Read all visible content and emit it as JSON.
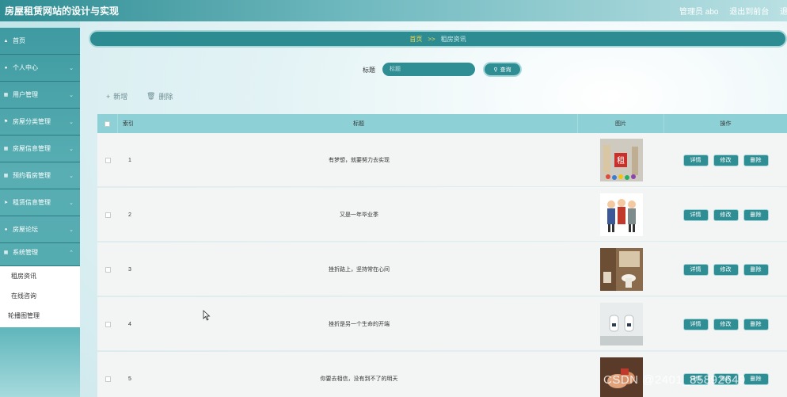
{
  "header": {
    "title": "房屋租赁网站的设计与实现",
    "user": "管理员 abo",
    "back_to_front": "退出到前台",
    "logout": "退出登"
  },
  "sidebar": {
    "items": [
      {
        "label": "首页",
        "icon": "home-icon"
      },
      {
        "label": "个人中心",
        "icon": "user-icon"
      },
      {
        "label": "用户管理",
        "icon": "grid-icon"
      },
      {
        "label": "房屋分类管理",
        "icon": "tag-icon"
      },
      {
        "label": "房屋信息管理",
        "icon": "grid-icon"
      },
      {
        "label": "预约看房管理",
        "icon": "grid-icon"
      },
      {
        "label": "租赁信息管理",
        "icon": "send-icon"
      },
      {
        "label": "房屋论坛",
        "icon": "user-icon"
      },
      {
        "label": "系统管理",
        "icon": "grid-icon"
      }
    ],
    "submenu": [
      "租房资讯",
      "在线咨询",
      "轮播图管理"
    ]
  },
  "breadcrumb": {
    "home": "首页",
    "separator": ">>",
    "current": "租房资讯"
  },
  "search": {
    "label": "标题",
    "placeholder": "标题",
    "button": "查询"
  },
  "toolbar": {
    "add": "新增",
    "delete": "删除"
  },
  "table": {
    "columns": [
      "索引",
      "标题",
      "图片",
      "操作"
    ],
    "actions": [
      "详情",
      "修改",
      "删除"
    ],
    "rows": [
      {
        "index": "1",
        "title": "有梦想，就要努力去实现",
        "image": "rent-sign-photo"
      },
      {
        "index": "2",
        "title": "又是一年毕业季",
        "image": "handshake-cartoon"
      },
      {
        "index": "3",
        "title": "挫折路上，坚持常在心间",
        "image": "bathroom-photo"
      },
      {
        "index": "4",
        "title": "挫折是另一个生命的开端",
        "image": "urinal-photo"
      },
      {
        "index": "5",
        "title": "你要去相信，没有到不了的明天",
        "image": "hands-photo"
      }
    ]
  },
  "watermark": "CSDN @2401_85892649",
  "colors": {
    "primary": "#2f8e94",
    "table_header": "#8dd1d7",
    "breadcrumb_home": "#f3d54e"
  }
}
